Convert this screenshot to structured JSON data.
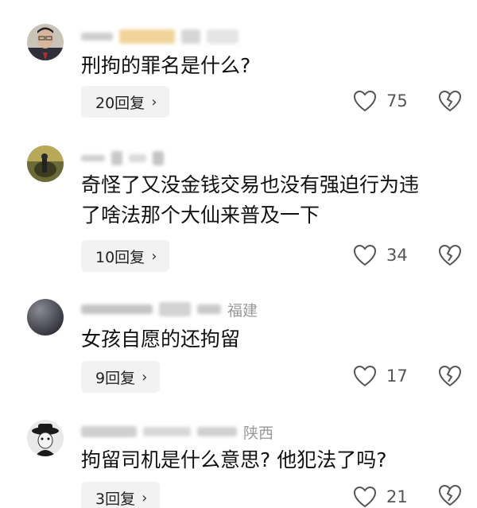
{
  "comments": [
    {
      "location": "",
      "text_lines": [
        "刑拘的罪名是什么?"
      ],
      "reply_label": "20回复",
      "likes": "75"
    },
    {
      "location": "",
      "text_lines": [
        "奇怪了又没金钱交易也没有强迫行为违",
        "了啥法那个大仙来普及一下"
      ],
      "reply_label": "10回复",
      "likes": "34"
    },
    {
      "location": "福建",
      "text_lines": [
        "女孩自愿的还拘留"
      ],
      "reply_label": "9回复",
      "likes": "17"
    },
    {
      "location": "陕西",
      "text_lines": [
        "拘留司机是什么意思? 他犯法了吗?"
      ],
      "reply_label": "3回复",
      "likes": "21"
    }
  ],
  "icons": {
    "reply_chevron": "chevron-right-icon",
    "like": "heart-icon",
    "dislike": "broken-heart-icon"
  },
  "colors": {
    "reply_bg": "#f2f2f2",
    "meta_gray": "#9a9a9a"
  }
}
